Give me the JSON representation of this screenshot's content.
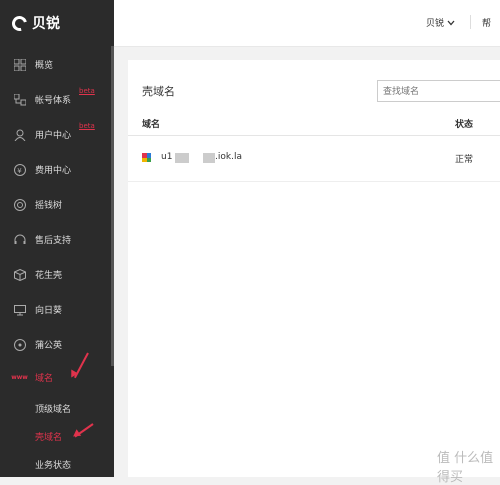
{
  "brand": {
    "name": "贝锐"
  },
  "sidebar": {
    "items": [
      {
        "label": "概览",
        "icon": "grid-icon"
      },
      {
        "label": "帐号体系",
        "icon": "account-system-icon",
        "badge": "beta"
      },
      {
        "label": "用户中心",
        "icon": "user-icon",
        "badge": "beta"
      },
      {
        "label": "费用中心",
        "icon": "yen-icon"
      },
      {
        "label": "摇钱树",
        "icon": "money-tree-icon"
      },
      {
        "label": "售后支持",
        "icon": "headset-icon"
      },
      {
        "label": "花生壳",
        "icon": "cube-icon"
      },
      {
        "label": "向日葵",
        "icon": "sunflower-icon"
      },
      {
        "label": "蒲公英",
        "icon": "dandelion-icon"
      },
      {
        "label": "域名",
        "icon": "www-icon",
        "icon_text": "www",
        "active": true
      }
    ],
    "subitems": [
      {
        "label": "顶级域名"
      },
      {
        "label": "壳域名",
        "active": true
      },
      {
        "label": "业务状态"
      }
    ]
  },
  "header": {
    "user": "贝锐",
    "cut_text": "帮"
  },
  "panel": {
    "title": "壳域名",
    "search_placeholder": "查找域名",
    "columns": [
      "域名",
      "状态"
    ],
    "rows": [
      {
        "domain_prefix": "u1",
        "domain_suffix": ".iok.la",
        "status": "正常"
      }
    ]
  },
  "watermark": "值 什么值得买",
  "colors": {
    "accent": "#e0334c",
    "sidebar_bg": "#2b2b2b"
  }
}
